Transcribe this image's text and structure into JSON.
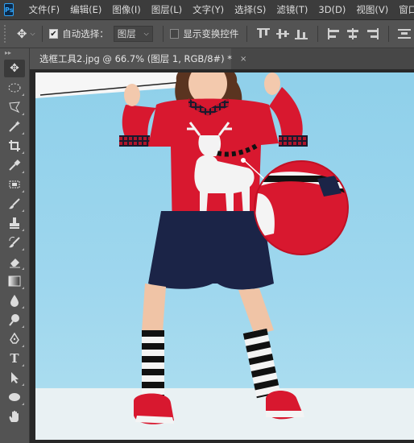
{
  "app": {
    "logo": "Ps"
  },
  "menu": [
    "文件(F)",
    "编辑(E)",
    "图像(I)",
    "图层(L)",
    "文字(Y)",
    "选择(S)",
    "滤镜(T)",
    "3D(D)",
    "视图(V)",
    "窗口"
  ],
  "options": {
    "auto_select_label": "自动选择：",
    "auto_select_checked": true,
    "auto_select_target": "图层",
    "show_transform_label": "显示变换控件",
    "show_transform_checked": false
  },
  "document": {
    "tab_title": "选框工具2.jpg @ 66.7% (图层 1, RGB/8#) *",
    "close_glyph": "×"
  },
  "tools": [
    {
      "name": "move-tool",
      "icon": "move-icon",
      "active": true
    },
    {
      "name": "marquee-tool",
      "icon": "ellipse-marquee-icon"
    },
    {
      "name": "lasso-tool",
      "icon": "polygon-lasso-icon"
    },
    {
      "name": "magic-wand-tool",
      "icon": "magic-wand-icon"
    },
    {
      "name": "crop-tool",
      "icon": "crop-icon"
    },
    {
      "name": "eyedropper-tool",
      "icon": "eyedropper-icon"
    },
    {
      "name": "healing-tool",
      "icon": "patch-icon"
    },
    {
      "name": "brush-tool",
      "icon": "brush-icon"
    },
    {
      "name": "stamp-tool",
      "icon": "stamp-icon"
    },
    {
      "name": "history-brush-tool",
      "icon": "history-brush-icon"
    },
    {
      "name": "eraser-tool",
      "icon": "eraser-icon"
    },
    {
      "name": "gradient-tool",
      "icon": "gradient-icon"
    },
    {
      "name": "blur-tool",
      "icon": "drop-icon"
    },
    {
      "name": "dodge-tool",
      "icon": "dodge-icon"
    },
    {
      "name": "pen-tool",
      "icon": "pen-icon"
    },
    {
      "name": "type-tool",
      "icon": "type-icon"
    },
    {
      "name": "path-select-tool",
      "icon": "arrow-icon"
    },
    {
      "name": "shape-tool",
      "icon": "ellipse-shape-icon"
    },
    {
      "name": "hand-tool",
      "icon": "hand-icon"
    }
  ]
}
